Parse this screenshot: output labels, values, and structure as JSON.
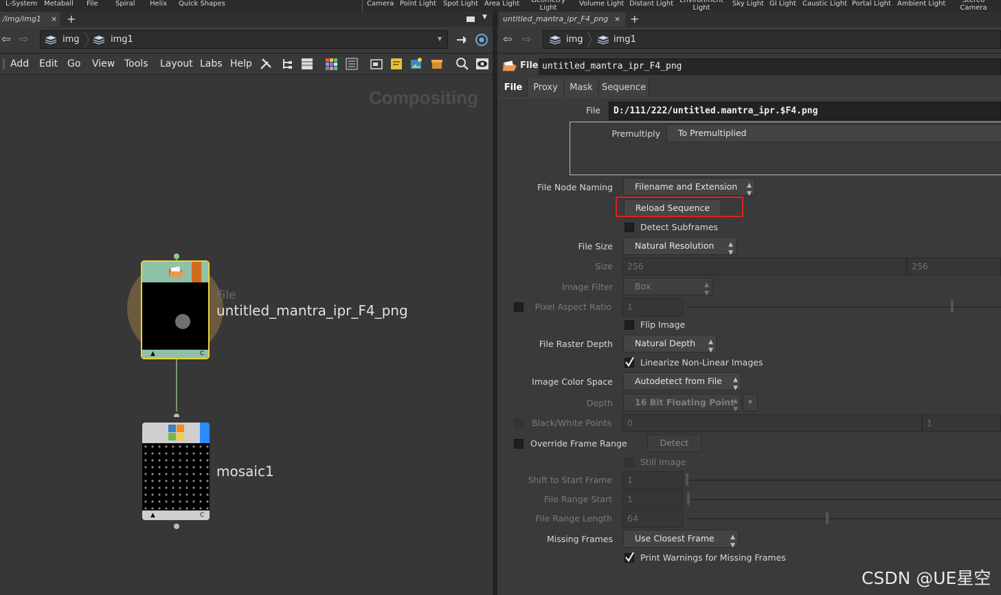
{
  "shelf": {
    "tools": [
      "L-System",
      "Metaball",
      "File",
      "Spiral",
      "Helix",
      "Quick Shapes",
      "Camera",
      "Point Light",
      "Spot Light",
      "Area Light",
      "Geometry Light",
      "Volume Light",
      "Distant Light",
      "Environment Light",
      "Sky Light",
      "GI Light",
      "Caustic Light",
      "Portal Light",
      "Ambient Light",
      "Stereo Camera"
    ]
  },
  "left_pane": {
    "tab_label": "/img/img1",
    "tab_close": "×",
    "tab_add": "+",
    "path": {
      "crumb1": "img",
      "crumb2": "img1"
    },
    "menu": [
      "Add",
      "Edit",
      "Go",
      "View",
      "Tools",
      "Layout",
      "Labs",
      "Help"
    ],
    "network_label": "Compositing",
    "nodes": {
      "file_node": {
        "type_label": "File",
        "name": "untitled_mantra_ipr_F4_png",
        "left_flag": "▲",
        "right_flag": "C"
      },
      "mosaic_node": {
        "name": "mosaic1",
        "left_flag": "▲",
        "right_flag": "C"
      }
    }
  },
  "right_pane": {
    "tab_label": "untitled_mantra_ipr_F4_png",
    "tab_close": "×",
    "tab_add": "+",
    "path": {
      "crumb1": "img",
      "crumb2": "img1"
    },
    "node_type": "File",
    "node_name": "untitled_mantra_ipr_F4_png",
    "tabs": [
      "File",
      "Proxy",
      "Mask",
      "Sequence"
    ],
    "params": {
      "file_label": "File",
      "file_value": "D:/111/222/untitled.mantra_ipr.$F4.png",
      "premultiply_label": "Premultiply",
      "premultiply_value": "To Premultiplied",
      "naming_label": "File Node Naming",
      "naming_value": "Filename and Extension",
      "reload_label": "Reload Sequence",
      "detect_subframes": "Detect Subframes",
      "file_size_label": "File Size",
      "file_size_value": "Natural Resolution",
      "size_label": "Size",
      "size_x": "256",
      "size_y": "256",
      "filter_label": "Image Filter",
      "filter_value": "Box",
      "aspect_label": "Pixel Aspect Ratio",
      "aspect_value": "1",
      "flip_label": "Flip Image",
      "raster_label": "File Raster Depth",
      "raster_value": "Natural Depth",
      "linearize_label": "Linearize Non-Linear Images",
      "colorspace_label": "Image Color Space",
      "colorspace_value": "Autodetect from File",
      "depth_label": "Depth",
      "depth_value": "16 Bit Floating Point",
      "bw_label": "Black/White Points",
      "bw_black": "0",
      "bw_white": "1",
      "override_label": "Override Frame Range",
      "detect_label": "Detect",
      "still_label": "Still Image",
      "shift_label": "Shift to Start Frame",
      "shift_value": "1",
      "range_start_label": "File Range Start",
      "range_start_value": "1",
      "range_length_label": "File Range Length",
      "range_length_value": "64",
      "missing_label": "Missing Frames",
      "missing_value": "Use Closest Frame",
      "print_warn_label": "Print Warnings for Missing Frames"
    }
  },
  "watermark": "CSDN @UE星空",
  "colors": {
    "highlight": "#e02020",
    "selected_node": "#f0d23c",
    "file_node_color": "#8fc1a6",
    "accent_blue": "#2a8cff"
  }
}
